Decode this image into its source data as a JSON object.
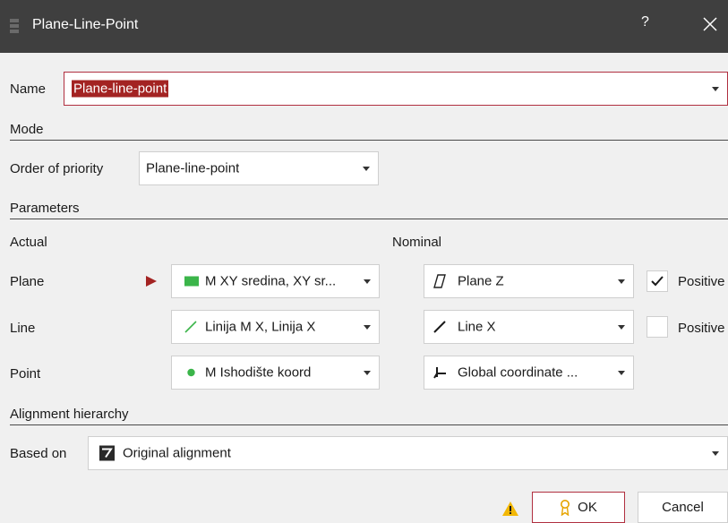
{
  "window": {
    "title": "Plane-Line-Point",
    "help_label": "?",
    "close_icon": "close-icon"
  },
  "name": {
    "label": "Name",
    "value": "Plane-line-point"
  },
  "mode": {
    "section": "Mode",
    "order_label": "Order of priority",
    "order_value": "Plane-line-point"
  },
  "parameters": {
    "section": "Parameters",
    "actual_header": "Actual",
    "nominal_header": "Nominal",
    "rows": [
      {
        "label": "Plane",
        "actual": "M XY sredina, XY sr...",
        "nominal": "Plane Z",
        "positive_label": "Positive",
        "positive_checked": true
      },
      {
        "label": "Line",
        "actual": "Linija M X, Linija X",
        "nominal": "Line X",
        "positive_label": "Positive",
        "positive_checked": false
      },
      {
        "label": "Point",
        "actual": "M Ishodište koord",
        "nominal": "Global coordinate ..."
      }
    ]
  },
  "alignment": {
    "section": "Alignment hierarchy",
    "based_on_label": "Based on",
    "based_on_value": "Original alignment"
  },
  "buttons": {
    "ok": "OK",
    "cancel": "Cancel"
  },
  "colors": {
    "accent": "#a32322",
    "plane_icon": "#3bb54a",
    "point_icon": "#3bb54a",
    "warning": "#f2b705"
  }
}
